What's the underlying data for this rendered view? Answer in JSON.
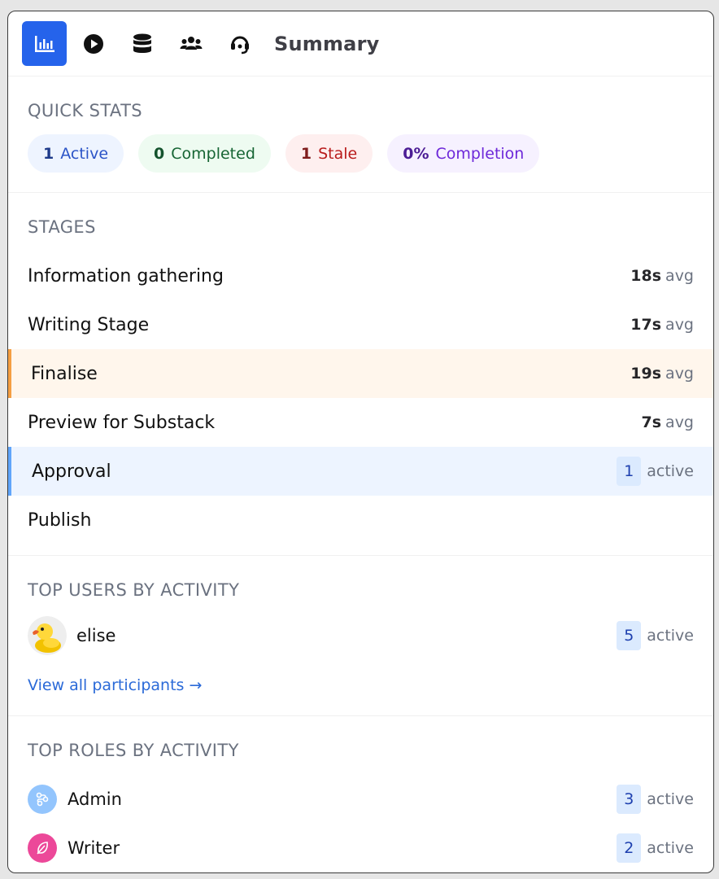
{
  "header": {
    "tabs": [
      {
        "icon": "bar-chart-icon",
        "active": true
      },
      {
        "icon": "play-icon",
        "active": false
      },
      {
        "icon": "database-icon",
        "active": false
      },
      {
        "icon": "users-icon",
        "active": false
      },
      {
        "icon": "headset-icon",
        "active": false
      }
    ],
    "title": "Summary"
  },
  "quick_stats": {
    "title": "QUICK STATS",
    "active": {
      "value": "1",
      "label": "Active",
      "color": "#eef4ff"
    },
    "completed": {
      "value": "0",
      "label": "Completed",
      "color": "#eefbf1"
    },
    "stale": {
      "value": "1",
      "label": "Stale",
      "color": "#feefef"
    },
    "completion": {
      "value": "0%",
      "label": "Completion",
      "color": "#f6f1ff"
    }
  },
  "stages": {
    "title": "STAGES",
    "items": [
      {
        "name": "Information gathering",
        "value": "18s",
        "unit": "avg"
      },
      {
        "name": "Writing Stage",
        "value": "17s",
        "unit": "avg"
      },
      {
        "name": "Finalise",
        "value": "19s",
        "unit": "avg",
        "highlight": "#f59e42"
      },
      {
        "name": "Preview for Substack",
        "value": "7s",
        "unit": "avg"
      },
      {
        "name": "Approval",
        "value": "1",
        "unit": "active",
        "highlight": "#60a5fa"
      },
      {
        "name": "Publish"
      }
    ]
  },
  "top_users": {
    "title": "TOP USERS BY ACTIVITY",
    "users": [
      {
        "name": "elise",
        "count": "5",
        "unit": "active",
        "avatar": "duck-avatar"
      }
    ],
    "view_all": "View all participants →"
  },
  "top_roles": {
    "title": "TOP ROLES BY ACTIVITY",
    "roles": [
      {
        "name": "Admin",
        "count": "3",
        "unit": "active",
        "icon": "workflow-icon",
        "color": "#93c5fd"
      },
      {
        "name": "Writer",
        "count": "2",
        "unit": "active",
        "icon": "feather-icon",
        "color": "#ec4899"
      }
    ]
  },
  "accent": "#2563eb"
}
